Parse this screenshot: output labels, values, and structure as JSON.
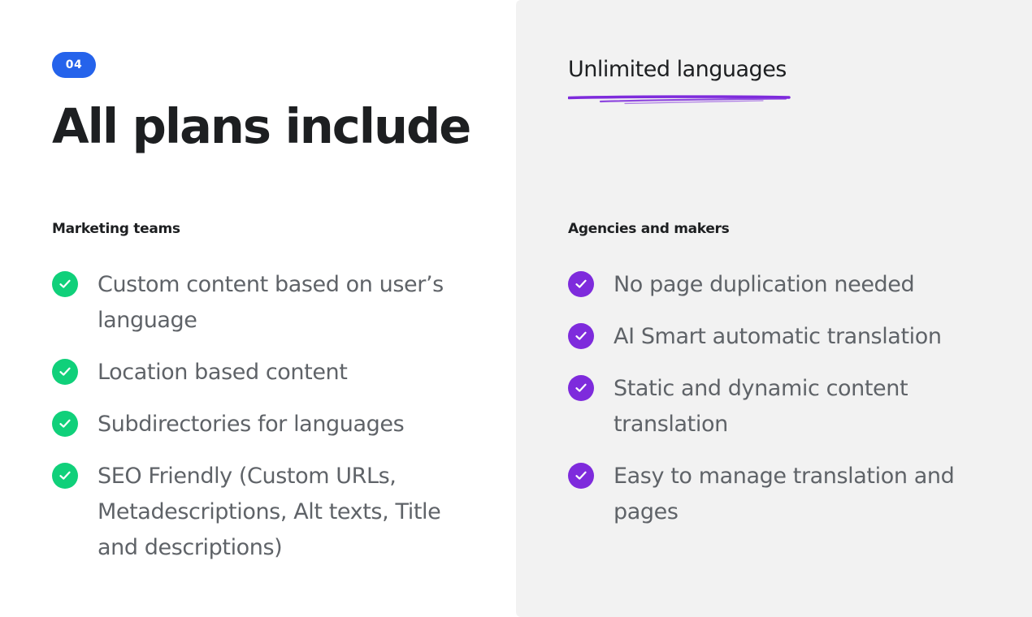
{
  "badge": "04",
  "title": "All plans include",
  "subtitle": "Unlimited languages",
  "colors": {
    "badge_bg": "#2563eb",
    "check_green": "#10d07a",
    "check_purple": "#7e2bdc",
    "right_panel_bg": "#f2f2f2"
  },
  "marketing": {
    "label": "Marketing teams",
    "items": [
      {
        "text": "Custom content based on user’s language"
      },
      {
        "text": "Location based content"
      },
      {
        "text": "Subdirectories for languages"
      },
      {
        "text": "SEO Friendly (Custom URLs, Metadescriptions, Alt texts, Title and descriptions)"
      }
    ]
  },
  "agencies": {
    "label": "Agencies and makers",
    "items": [
      {
        "text": "No page duplication needed"
      },
      {
        "text": "AI Smart automatic translation"
      },
      {
        "text": "Static and dynamic content translation"
      },
      {
        "text": "Easy to manage translation and pages"
      }
    ]
  }
}
